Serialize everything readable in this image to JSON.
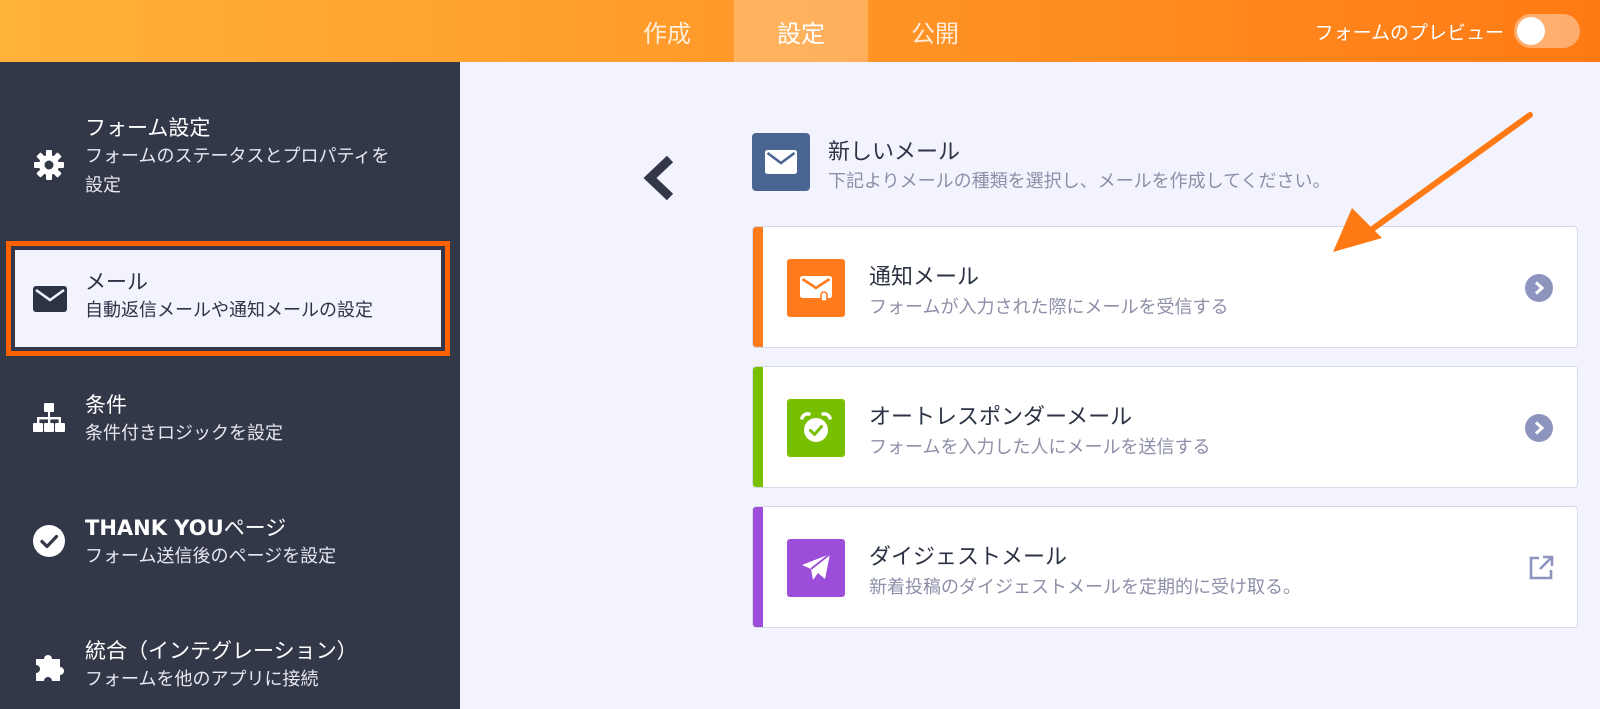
{
  "topbar": {
    "tabs": [
      {
        "label": "作成"
      },
      {
        "label": "設定"
      },
      {
        "label": "公開"
      }
    ],
    "active_tab": 1,
    "preview_label": "フォームのプレビュー"
  },
  "sidebar": {
    "items": [
      {
        "icon": "gear-icon",
        "title": "フォーム設定",
        "subtitle_1": "フォームのステータスとプロパティを",
        "subtitle_2": "設定"
      },
      {
        "icon": "envelope-icon",
        "title": "メール",
        "subtitle": "自動返信メールや通知メールの設定"
      },
      {
        "icon": "sitemap-icon",
        "title": "条件",
        "subtitle": "条件付きロジックを設定"
      },
      {
        "icon": "check-circle-icon",
        "title_bold": "THANK YOU",
        "title_rest": "ページ",
        "subtitle": "フォーム送信後のページを設定"
      },
      {
        "icon": "puzzle-icon",
        "title": "統合（インテグレーション）",
        "subtitle": "フォームを他のアプリに接続"
      }
    ],
    "active_item": 1
  },
  "main": {
    "header": {
      "icon": "envelope-icon",
      "title": "新しいメール",
      "subtitle": "下記よりメールの種類を選択し、メールを作成してください。"
    },
    "cards": [
      {
        "title": "通知メール",
        "subtitle": "フォームが入力された際にメールを受信する",
        "icon": "notification-envelope-icon",
        "color": "#ff7b1c",
        "action_icon": "chevron-right-circle-icon"
      },
      {
        "title": "オートレスポンダーメール",
        "subtitle": "フォームを入力した人にメールを送信する",
        "icon": "alarm-clock-icon",
        "color": "#78bf00",
        "action_icon": "chevron-right-circle-icon"
      },
      {
        "title": "ダイジェストメール",
        "subtitle": "新着投稿のダイジェストメールを定期的に受け取る。",
        "icon": "paper-plane-icon",
        "color": "#9c4dd9",
        "action_icon": "external-link-icon"
      }
    ]
  },
  "colors": {
    "topbar_start": "#ffb23a",
    "topbar_end": "#ff7a14",
    "sidebar_bg": "#333849",
    "highlight_border": "#ff6100",
    "annotation_arrow": "#ff7a14"
  }
}
